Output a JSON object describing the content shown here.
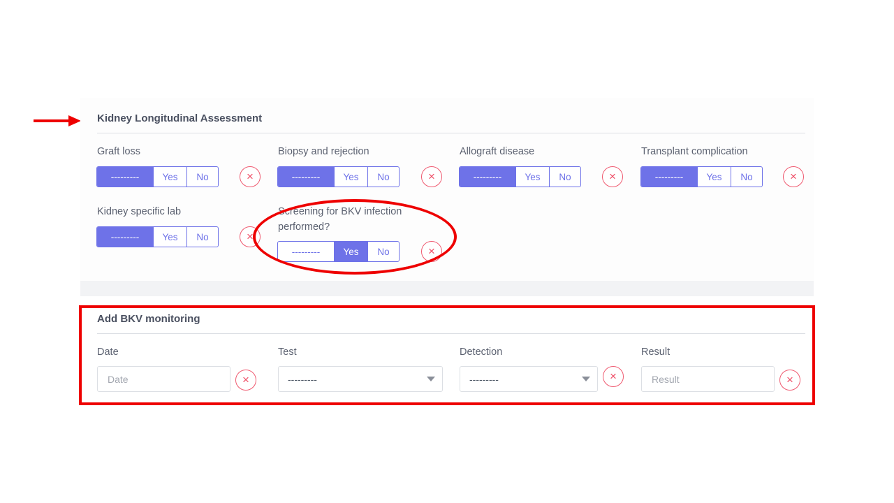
{
  "assessment": {
    "title": "Kidney Longitudinal Assessment",
    "fields": [
      {
        "label": "Graft loss",
        "options": [
          "---------",
          "Yes",
          "No"
        ],
        "selected": "---------"
      },
      {
        "label": "Biopsy and rejection",
        "options": [
          "---------",
          "Yes",
          "No"
        ],
        "selected": "---------"
      },
      {
        "label": "Allograft disease",
        "options": [
          "---------",
          "Yes",
          "No"
        ],
        "selected": "---------"
      },
      {
        "label": "Transplant complication",
        "options": [
          "---------",
          "Yes",
          "No"
        ],
        "selected": "---------"
      },
      {
        "label": "Kidney specific lab",
        "options": [
          "---------",
          "Yes",
          "No"
        ],
        "selected": "---------"
      },
      {
        "label_line1": "Screening for BKV infection",
        "label_line2": "performed?",
        "options": [
          "---------",
          "Yes",
          "No"
        ],
        "selected": "Yes"
      }
    ],
    "clear_icon": "×"
  },
  "bkv_monitoring": {
    "title": "Add BKV monitoring",
    "date": {
      "label": "Date",
      "placeholder": "Date",
      "value": ""
    },
    "test": {
      "label": "Test",
      "selected": "---------"
    },
    "detection": {
      "label": "Detection",
      "selected": "---------"
    },
    "result": {
      "label": "Result",
      "placeholder": "Result",
      "value": ""
    }
  },
  "annotations": {
    "arrow_color": "#ee0000",
    "highlight_color": "#ee0000"
  },
  "colors": {
    "accent": "#6e72e8",
    "danger": "#ef4d66"
  }
}
